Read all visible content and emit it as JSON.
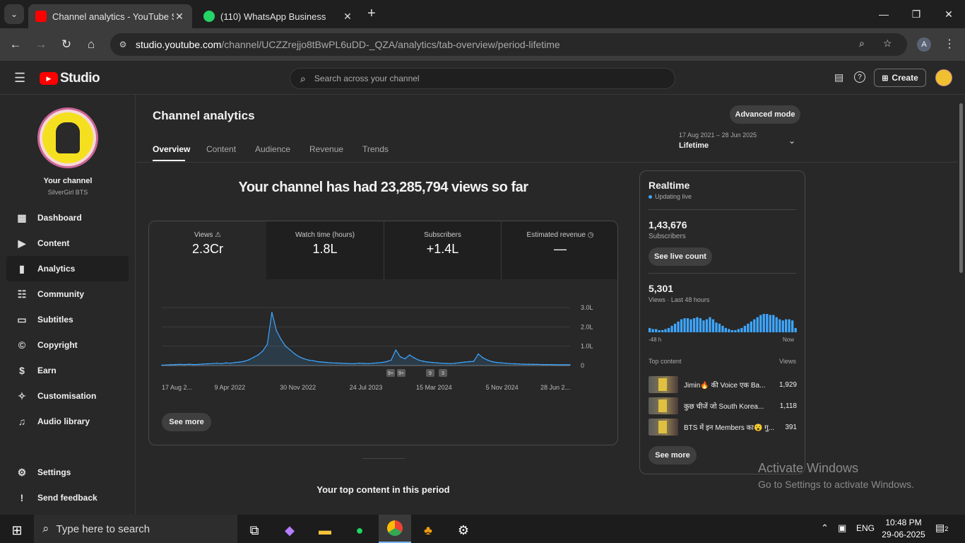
{
  "browser": {
    "tabs": [
      {
        "title": "Channel analytics - YouTube Studio",
        "active": true
      },
      {
        "title": "(110) WhatsApp Business",
        "active": false
      }
    ],
    "url_host": "studio.youtube.com",
    "url_path": "/channel/UCZZrejjo8tBwPL6uDD-_QZA/analytics/tab-overview/period-lifetime",
    "profile_initial": "A"
  },
  "header": {
    "logo_text": "Studio",
    "search_placeholder": "Search across your channel",
    "create_label": "Create"
  },
  "sidebar": {
    "channel_title": "Your channel",
    "channel_name": "SilverGirl BTS",
    "items": [
      {
        "label": "Dashboard",
        "icon": "dashboard-icon"
      },
      {
        "label": "Content",
        "icon": "content-icon"
      },
      {
        "label": "Analytics",
        "icon": "analytics-icon"
      },
      {
        "label": "Community",
        "icon": "community-icon"
      },
      {
        "label": "Subtitles",
        "icon": "subtitles-icon"
      },
      {
        "label": "Copyright",
        "icon": "copyright-icon"
      },
      {
        "label": "Earn",
        "icon": "earn-icon"
      },
      {
        "label": "Customisation",
        "icon": "customisation-icon"
      },
      {
        "label": "Audio library",
        "icon": "audio-library-icon"
      }
    ],
    "settings_label": "Settings",
    "feedback_label": "Send feedback"
  },
  "main": {
    "title": "Channel analytics",
    "advanced_mode_label": "Advanced mode",
    "tabs": [
      "Overview",
      "Content",
      "Audience",
      "Revenue",
      "Trends"
    ],
    "date_range": "17 Aug 2021 – 28 Jun 2025",
    "period_label": "Lifetime",
    "headline": "Your channel has had 23,285,794 views so far",
    "stats": [
      {
        "label": "Views",
        "value": "2.3Cr"
      },
      {
        "label": "Watch time (hours)",
        "value": "1.8L"
      },
      {
        "label": "Subscribers",
        "value": "+1.4L"
      },
      {
        "label": "Estimated revenue",
        "value": "—"
      }
    ],
    "see_more_label": "See more",
    "top_content_heading": "Your top content in this period",
    "chart_markers": [
      "9+",
      "9+",
      "9",
      "3"
    ]
  },
  "chart_data": {
    "type": "area",
    "x_tick_labels": [
      "17 Aug 2...",
      "9 Apr 2022",
      "30 Nov 2022",
      "24 Jul 2023",
      "15 Mar 2024",
      "5 Nov 2024",
      "28 Jun 2..."
    ],
    "y_tick_labels": [
      "3.0L",
      "2.0L",
      "1.0L",
      "0"
    ],
    "ylim": [
      0,
      3.0
    ],
    "y_unit": "L",
    "series": [
      {
        "values": [
          0.02,
          0.03,
          0.04,
          0.05,
          0.06,
          0.05,
          0.07,
          0.05,
          0.06,
          0.08,
          0.09,
          0.1,
          0.12,
          0.1,
          0.14,
          0.12,
          0.16,
          0.18,
          0.22,
          0.3,
          0.42,
          0.55,
          0.75,
          1.1,
          2.75,
          1.8,
          1.35,
          1.0,
          0.8,
          0.6,
          0.45,
          0.35,
          0.28,
          0.25,
          0.2,
          0.18,
          0.16,
          0.14,
          0.13,
          0.12,
          0.11,
          0.1,
          0.1,
          0.12,
          0.11,
          0.1,
          0.12,
          0.14,
          0.16,
          0.2,
          0.28,
          0.8,
          0.45,
          0.35,
          0.55,
          0.4,
          0.28,
          0.22,
          0.18,
          0.16,
          0.14,
          0.12,
          0.11,
          0.1,
          0.12,
          0.15,
          0.18,
          0.2,
          0.22,
          0.6,
          0.4,
          0.28,
          0.2,
          0.16,
          0.14,
          0.12,
          0.1,
          0.09,
          0.08,
          0.07,
          0.07,
          0.06,
          0.06,
          0.05,
          0.05,
          0.05,
          0.04,
          0.04,
          0.04,
          0.04
        ]
      }
    ],
    "grid": true
  },
  "realtime": {
    "title": "Realtime",
    "status": "Updating live",
    "subscribers_value": "1,43,676",
    "subscribers_label": "Subscribers",
    "see_live_count_label": "See live count",
    "views_value": "5,301",
    "views_label": "Views · Last 48 hours",
    "bars": [
      4,
      3,
      3,
      2,
      2,
      3,
      4,
      6,
      8,
      10,
      12,
      13,
      13,
      12,
      13,
      14,
      13,
      11,
      12,
      14,
      12,
      9,
      8,
      6,
      4,
      3,
      2,
      2,
      3,
      4,
      6,
      8,
      10,
      12,
      14,
      16,
      17,
      17,
      16,
      16,
      14,
      12,
      11,
      12,
      12,
      11,
      4
    ],
    "axis_start": "-48 h",
    "axis_end": "Now",
    "top_content_label": "Top content",
    "top_content_views_label": "Views",
    "top_content": [
      {
        "title": "Jimin🔥 की Voice एक Ba...",
        "views": "1,929"
      },
      {
        "title": "कुछ चीजें जो South Korea...",
        "views": "1,118"
      },
      {
        "title": "BTS में इन Members का😮 गु...",
        "views": "391"
      }
    ],
    "see_more_label": "See more"
  },
  "watermark": {
    "line1": "Activate Windows",
    "line2": "Go to Settings to activate Windows."
  },
  "taskbar": {
    "search_placeholder": "Type here to search",
    "language": "ENG",
    "time": "10:48 PM",
    "date": "29-06-2025",
    "notification_count": "2"
  },
  "colors": {
    "chart_line": "#3ea6ff",
    "youtube_red": "#ff0000",
    "live_dot": "#3ea6ff"
  }
}
